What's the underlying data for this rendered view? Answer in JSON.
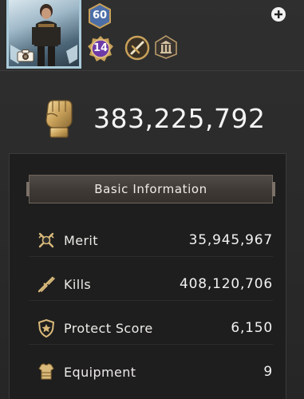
{
  "profile": {
    "level": "60",
    "rank": "14"
  },
  "power": {
    "value": "383,225,792"
  },
  "panel": {
    "title": "Basic Information",
    "stats": [
      {
        "label": "Merit",
        "value": "35,945,967",
        "icon": "crossed-swords-icon"
      },
      {
        "label": "Kills",
        "value": "408,120,706",
        "icon": "broken-swords-icon"
      },
      {
        "label": "Protect Score",
        "value": "6,150",
        "icon": "shield-star-icon"
      },
      {
        "label": "Equipment",
        "value": "9",
        "icon": "armor-icon"
      }
    ]
  },
  "colors": {
    "accent_gold": "#c9a15a",
    "panel_bg": "#1e1e1e",
    "page_bg": "#2a2a2a",
    "level_badge": "#4d6fa8",
    "rank_badge": "#6e3aa8"
  }
}
